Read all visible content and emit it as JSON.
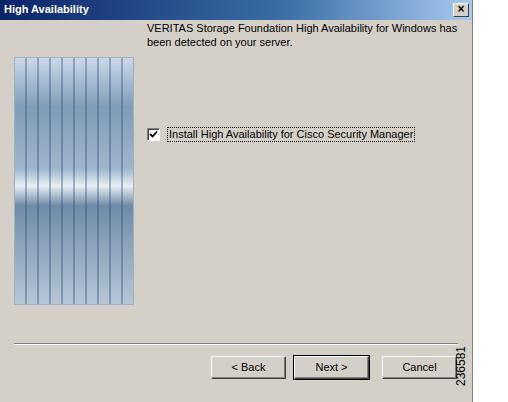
{
  "window": {
    "title": "High Availability",
    "close": "×"
  },
  "message": "VERITAS Storage Foundation High Availability for Windows has been detected on your server.",
  "option": {
    "label": "Install High Availability for Cisco Security Manager",
    "checked": true
  },
  "buttons": [
    {
      "label": "< Back",
      "default": false
    },
    {
      "label": "Next >",
      "default": true
    },
    {
      "label": "Cancel",
      "default": false
    }
  ],
  "figure_id": "236581"
}
